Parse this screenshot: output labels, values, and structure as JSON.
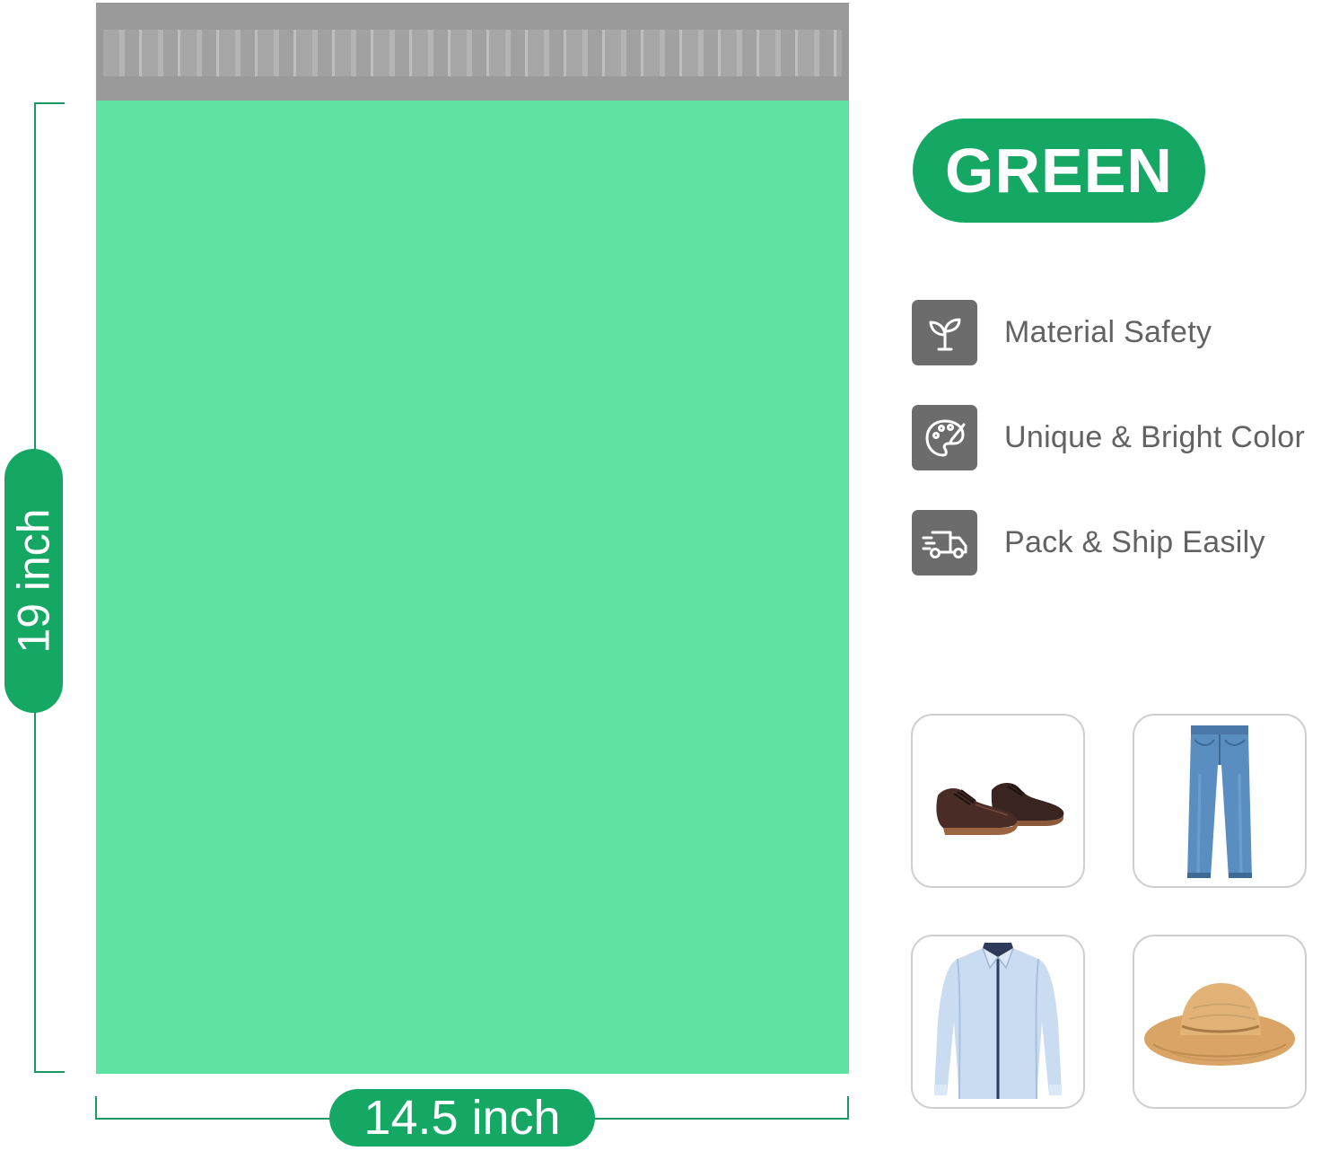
{
  "colors": {
    "mailer_green": "#5fe3a5",
    "accent_green": "#14a864",
    "seal_strip_gray": "#9a9a9a",
    "icon_gray": "#6c6c6c",
    "text_gray": "#626262"
  },
  "product": {
    "color_name": "GREEN"
  },
  "dimensions": {
    "height_label": "19 inch",
    "width_label": "14.5 inch"
  },
  "features": [
    {
      "icon": "sprout-icon",
      "label": "Material Safety"
    },
    {
      "icon": "palette-icon",
      "label": "Unique & Bright Color"
    },
    {
      "icon": "delivery-truck-icon",
      "label": "Pack & Ship Easily"
    }
  ],
  "use_cases": [
    {
      "icon": "dress-shoes-icon"
    },
    {
      "icon": "jeans-icon"
    },
    {
      "icon": "dress-shirt-icon"
    },
    {
      "icon": "sun-hat-icon"
    }
  ]
}
